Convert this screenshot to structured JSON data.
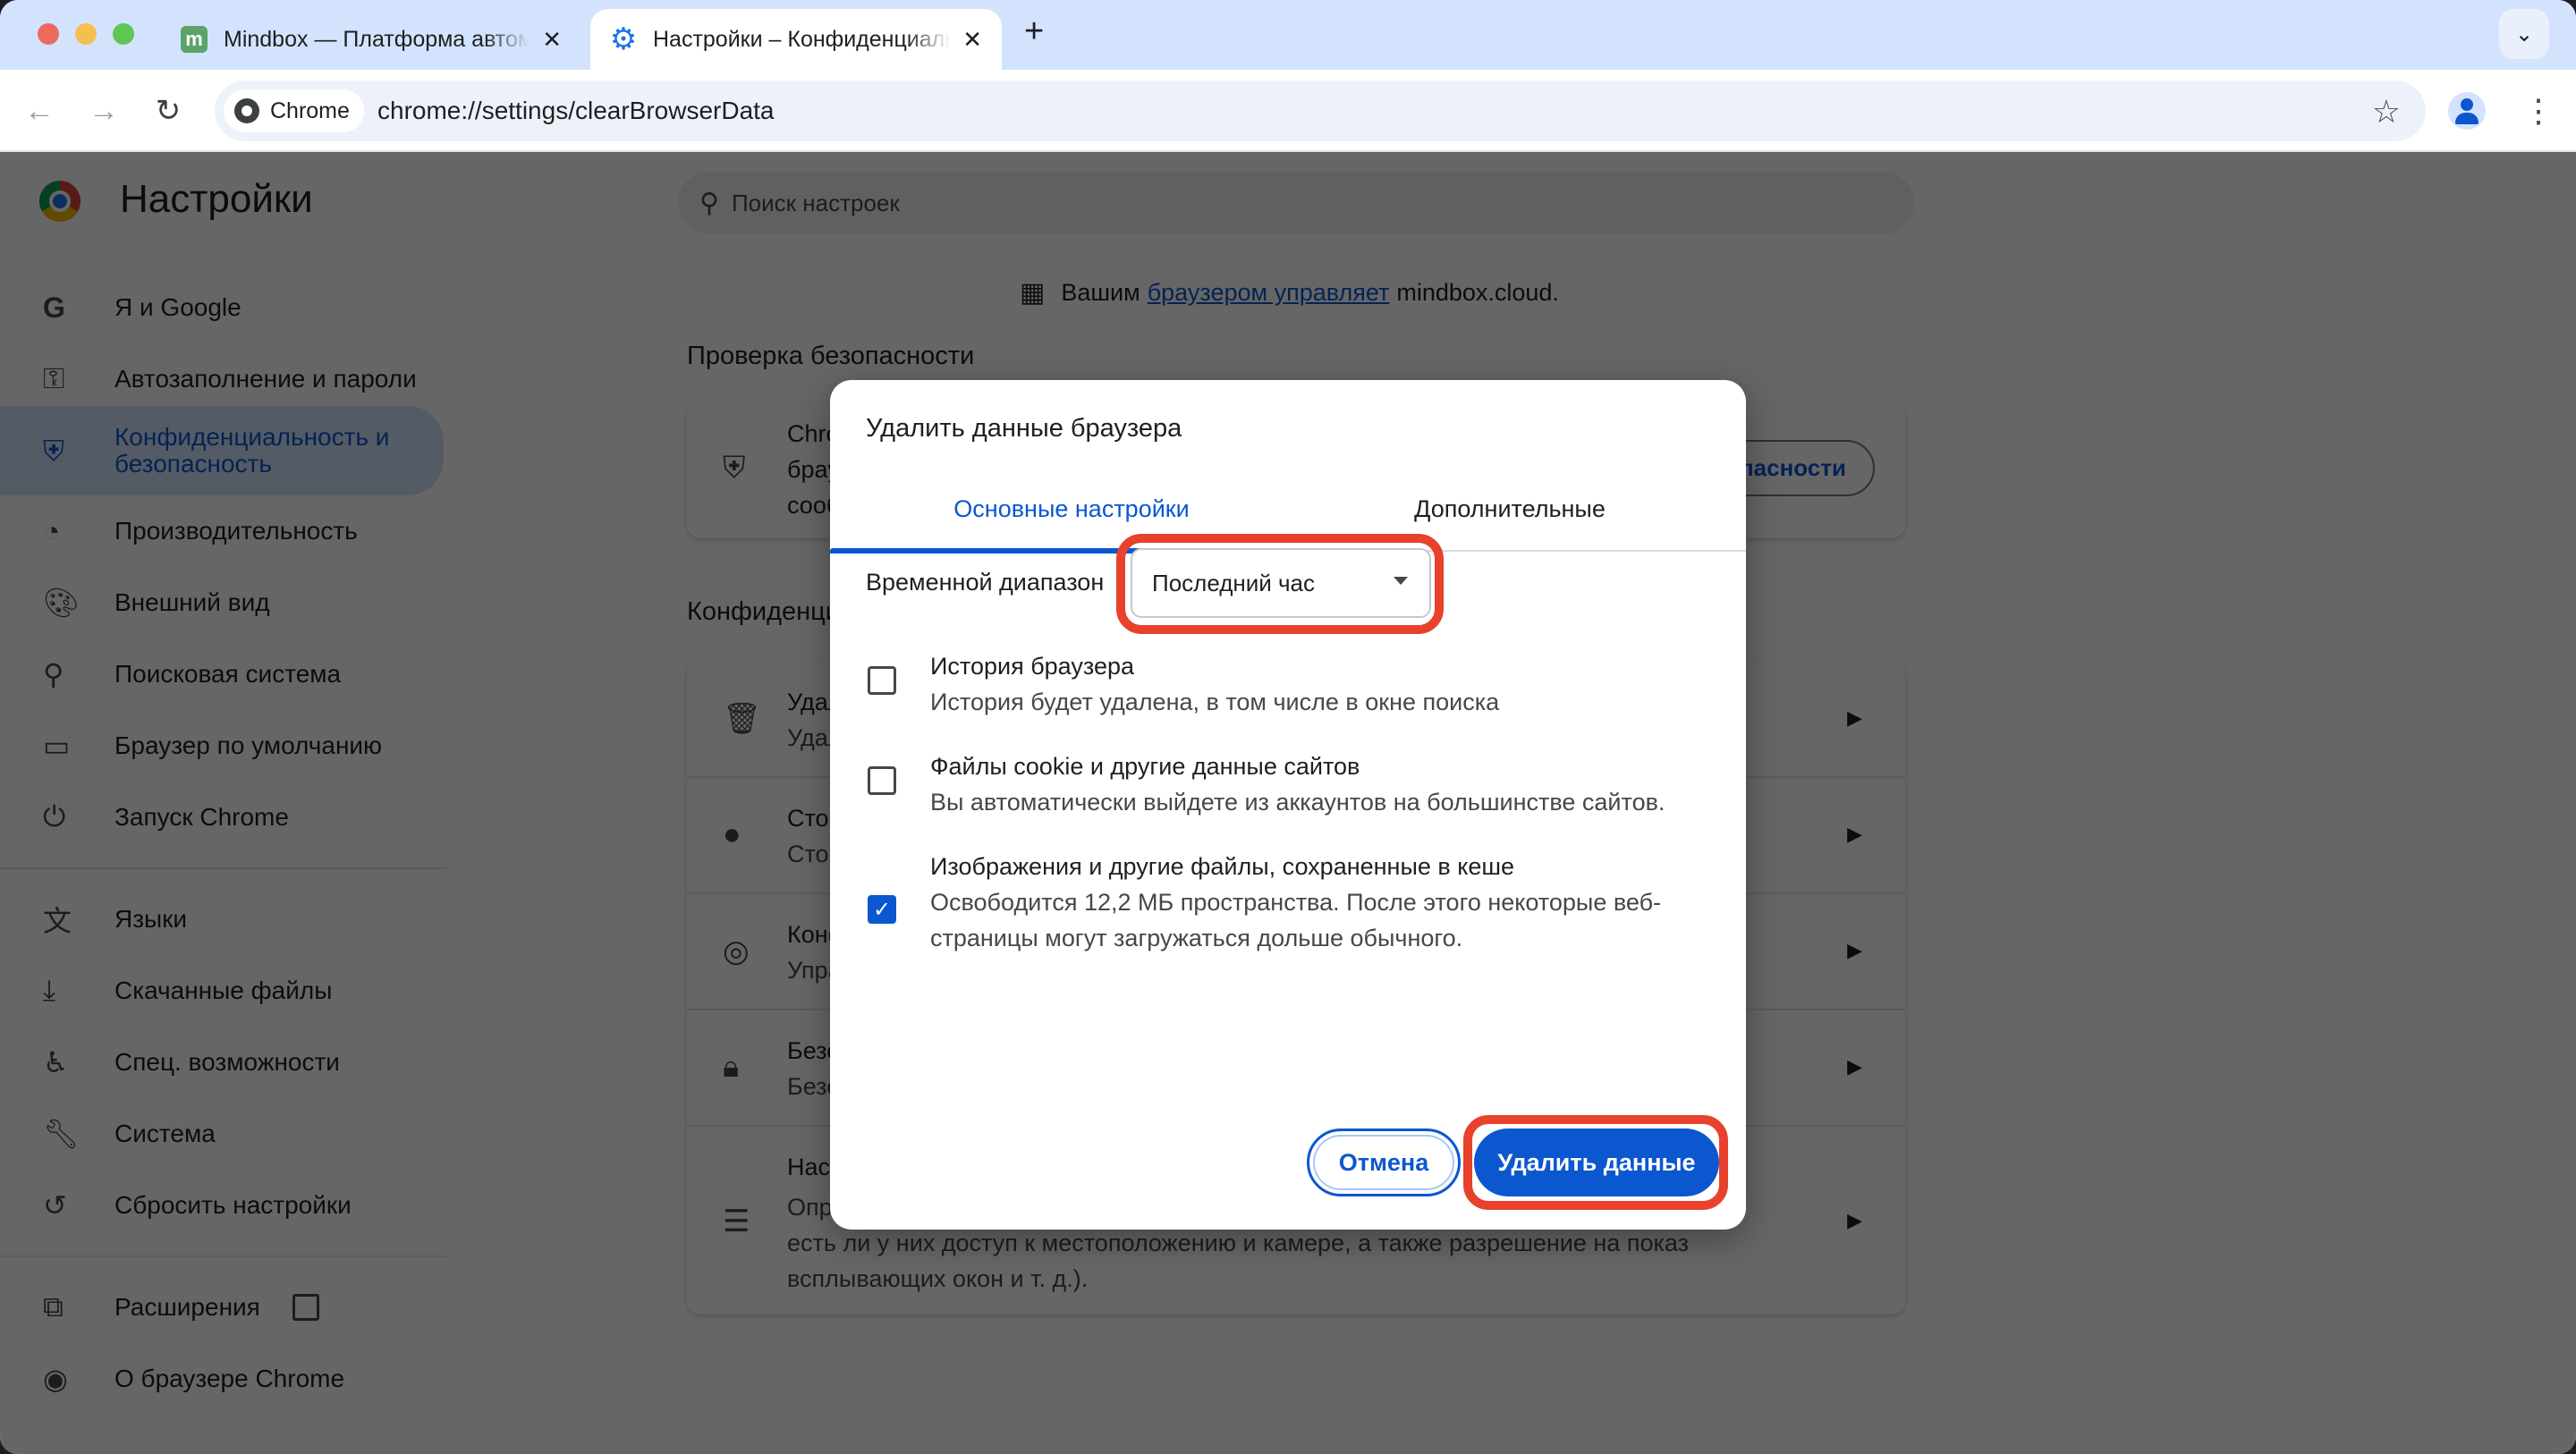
{
  "browser": {
    "tabs": [
      {
        "title": "Mindbox — Платформа автоматизации маркетинга",
        "favicon": "m",
        "active": false
      },
      {
        "title": "Настройки – Конфиденциальность и безопасность",
        "favicon": "gear-icon",
        "active": true
      }
    ],
    "new_tab_label": "+",
    "chip_label": "Chrome",
    "url_prefix": "chrome://",
    "url_host": "settings",
    "url_path": "/clearBrowserData"
  },
  "settings": {
    "title": "Настройки",
    "search_placeholder": "Поиск настроек",
    "managed_prefix": "Вашим",
    "managed_link": "браузером управляет",
    "managed_suffix": "mindbox.cloud.",
    "sidebar": {
      "items": [
        {
          "label": "Я и Google",
          "icon": "google-icon"
        },
        {
          "label": "Автозаполнение и пароли",
          "icon": "key-icon"
        },
        {
          "label": "Конфиденциальность и безопасность",
          "icon": "shield-icon",
          "selected": true
        },
        {
          "label": "Производительность",
          "icon": "speedometer-icon"
        },
        {
          "label": "Внешний вид",
          "icon": "palette-icon"
        },
        {
          "label": "Поисковая система",
          "icon": "search-icon"
        },
        {
          "label": "Браузер по умолчанию",
          "icon": "browser-window-icon"
        },
        {
          "label": "Запуск Chrome",
          "icon": "power-icon"
        },
        {
          "label": "Языки",
          "icon": "translate-icon"
        },
        {
          "label": "Скачанные файлы",
          "icon": "download-icon"
        },
        {
          "label": "Спец. возможности",
          "icon": "accessibility-icon"
        },
        {
          "label": "Система",
          "icon": "wrench-icon"
        },
        {
          "label": "Сбросить настройки",
          "icon": "reset-icon"
        },
        {
          "label": "Расширения",
          "icon": "puzzle-icon"
        },
        {
          "label": "О браузере Chrome",
          "icon": "chrome-icon"
        }
      ]
    },
    "safety_check": {
      "heading": "Проверка безопасности",
      "text_line1": "Chrome",
      "text_line2": "брау",
      "text_line3": "сооб",
      "button_label": "Перейти к проверке безопасности"
    },
    "privacy": {
      "heading": "Конфиденциальность и безопасность",
      "rows": [
        {
          "title": "Удалить данные о работе в браузере",
          "subtitle": "Удалить файлы cookie и данные сайтов, очистить историю и кеш",
          "icon": "trash-icon"
        },
        {
          "title": "Сторонние файлы cookie",
          "subtitle": "Сторонние файлы cookie заблокированы в режиме инкогнито",
          "icon": "cookie-icon"
        },
        {
          "title": "Конфиденциальность в рекламе",
          "subtitle": "Управляйте информацией, которую сайты используют для показа рекламы",
          "icon": "ads-icon"
        },
        {
          "title": "Безопасность",
          "subtitle": "Безопасный просмотр и другие настройки безопасности",
          "icon": "lock-icon"
        },
        {
          "title": "Настройки сайтов",
          "subtitle": "Определяет, какую информацию могут использовать и показывать сайты (например, есть ли у них доступ к местоположению и камере, а также разрешение на показ всплывающих окон и т. д.).",
          "icon": "tune-icon"
        }
      ]
    }
  },
  "dialog": {
    "title": "Удалить данные браузера",
    "tabs": [
      "Основные настройки",
      "Дополнительные"
    ],
    "active_tab": 0,
    "time_range_label": "Временной диапазон",
    "time_range_value": "Последний час",
    "options": [
      {
        "title": "История браузера",
        "description": "История будет удалена, в том числе в окне поиска",
        "checked": false
      },
      {
        "title": "Файлы cookie и другие данные сайтов",
        "description": "Вы автоматически выйдете из аккаунтов на большинстве сайтов.",
        "checked": false
      },
      {
        "title": "Изображения и другие файлы, сохраненные в кеше",
        "description": "Освободится 12,2 МБ пространства. После этого некоторые веб-страницы могут загружаться дольше обычного.",
        "checked": true
      }
    ],
    "cancel_label": "Отмена",
    "confirm_label": "Удалить данные"
  },
  "colors": {
    "accent": "#0b57d0",
    "highlight": "#e8412c",
    "tabstrip": "#d3e3fd"
  }
}
